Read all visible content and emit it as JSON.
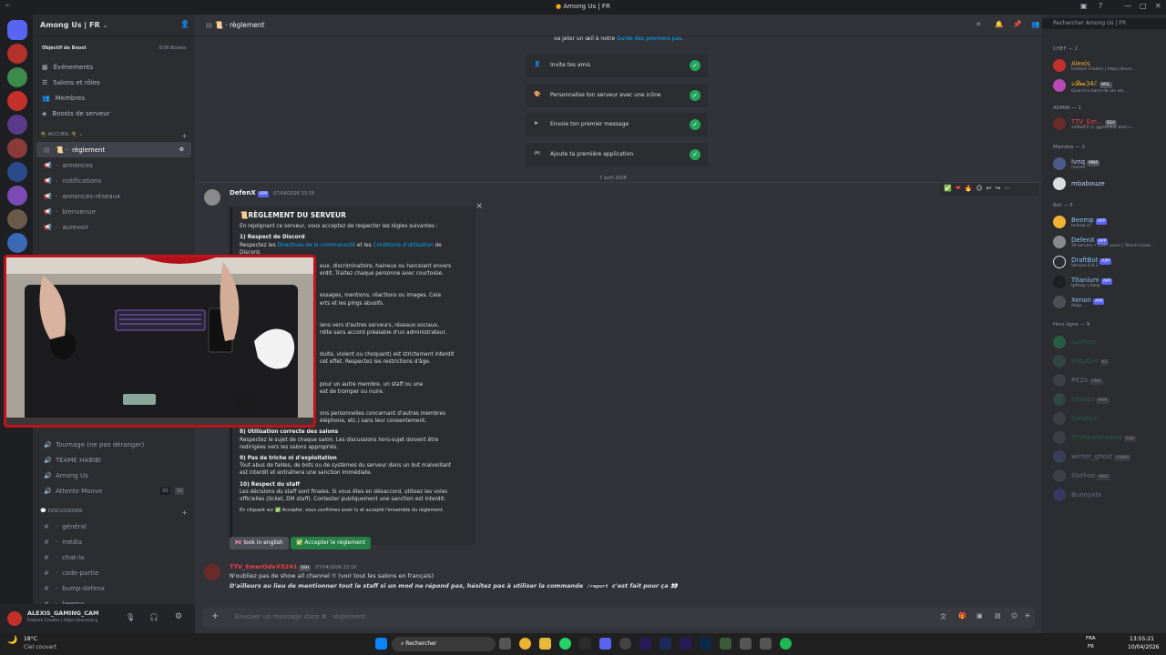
{
  "window": {
    "title": "Among Us | FR"
  },
  "server": {
    "name": "Among Us | FR",
    "boost_label": "Objectif de Boost",
    "boost_count": "0/36 Boosts"
  },
  "menu": [
    "Événements",
    "Salons et rôles",
    "Membres",
    "Boosts de serveur"
  ],
  "categories": {
    "accueil": "ACCUEIL",
    "discussions": "DISCUSSIONS"
  },
  "channels_top": [
    {
      "name": "règlement",
      "selected": true
    },
    {
      "name": "annonces"
    },
    {
      "name": "notifications"
    },
    {
      "name": "annonces-réseaux"
    },
    {
      "name": "bienvenue"
    },
    {
      "name": "aurevoir"
    }
  ],
  "voice_channels": [
    {
      "name": "Tournage (ne pas déranger)"
    },
    {
      "name": "TEAME HABIBI"
    },
    {
      "name": "Among Us"
    },
    {
      "name": "Attente Moove",
      "count_a": "00",
      "count_b": "10"
    }
  ],
  "channels_disc": [
    "général",
    "média",
    "chat-ia",
    "code-partie",
    "bump-defenx",
    "beemo"
  ],
  "user": {
    "name": "ALEXIS_GAMING_CAM",
    "status": "Embark Creator | https://kureect.g"
  },
  "header": {
    "channel": "règlement",
    "search_placeholder": "Rechercher Among Us | FR"
  },
  "welcome": {
    "text_before": "va jeter un œil à notre ",
    "link": "Guide des premiers pas",
    "items": [
      "Invite tes amis",
      "Personnalise ton serveur avec une icône",
      "Envoie ton premier message",
      "Ajoute ta première application"
    ],
    "check": "✓"
  },
  "date_divider": "7 avril 2026",
  "message1": {
    "author": "DefenX",
    "badge": "APP",
    "time": "07/04/2026 23:19",
    "close": "×",
    "embed": {
      "title": "RÈGLEMENT DU SERVEUR",
      "intro": "En rejoignant ce serveur, vous acceptez de respecter les règles suivantes :",
      "r1_title": "1) Respect de Discord",
      "r1_a": "Respectez les ",
      "r1_link1": "Directives de la communauté",
      "r1_b": " et les ",
      "r1_link2": "Conditions d'utilisation",
      "r1_c": " de",
      "r1_d": "Discord.",
      "r2_a": "eux, discriminatoire, haineux ou harcelant envers",
      "r2_b": "erdit. Traitez chaque personne avec courtoisie.",
      "r3_a": "essages, mentions, réactions ou images. Cela",
      "r3_b": "erts et les pings abusifs.",
      "r4_a": "iens vers d'autres serveurs, réseaux sociaux,",
      "r4_b": "rdite sans accord préalable d'un administrateur.",
      "r5_a": "dulte, violent ou choquant) est strictement interdit",
      "r5_b": "cet effet. Respectez les restrictions d'âge.",
      "r6_a": "pour un autre membre, un staff ou une",
      "r6_b": "est de tromper ou nuire.",
      "r7_a": "ons personnelles concernant d'autres membres",
      "r7_b": "éléphone, etc.) sans leur consentement.",
      "r8_title": "8) Utilisation correcte des salons",
      "r8_a": "Respectez le sujet de chaque salon. Les discussions hors-sujet doivent être",
      "r8_b": "redirigées vers les salons appropriés.",
      "r9_title": "9) Pas de triche ni d'exploitation",
      "r9_a": "Tout abus de failles, de bots ou de systèmes du serveur dans un but malveillant",
      "r9_b": "est interdit et entraînera une sanction immédiate.",
      "r10_title": "10) Respect du staff",
      "r10_a": "Les décisions du staff sont finales. Si vous êtes en désaccord, utilisez les voies",
      "r10_b": "officielles (ticket, DM staff). Contester publiquement une sanction est interdit.",
      "footer": "En cliquant sur ✅ Accepter, vous confirmez avoir lu et accepté l'ensemble du règlement."
    },
    "btn_english": "look in english",
    "btn_accept": "Accepter le règlement"
  },
  "message2": {
    "author": "TTV_EmerOde#5241",
    "badge": "SSH",
    "time": "07/04/2026 23:19",
    "line1": "N'oubliez pas de show all channel !! (voir tout les salons en français)",
    "line2_a": "D'ailleurs au lieu de mentionner tout le staff si un mod ne répond pas, hésitez pas à utiliser la commande ",
    "line2_cmd": "/report",
    "line2_b": " c'est fait pour ça 👀"
  },
  "input": {
    "placeholder": "Envoyer un message dans # · règlement"
  },
  "members": {
    "cat_chef": "CHEF — 2",
    "cat_admin": "ADMIN — 1",
    "cat_membre": "Membre — 2",
    "cat_bot": "Bot — 5",
    "cat_offline": "Hors ligne — 9",
    "chef": [
      {
        "name": "Alexis",
        "sub": "Embark Creator | https://kure..."
      },
      {
        "name": "ঌ𝓓𝓮𝓮ℨ4ℰ",
        "tag": "WSL",
        "sub": "Quand la barre de vie est..."
      }
    ],
    "admin": [
      {
        "name": "TTV_Em...",
        "tag": "SSH",
        "sub": "selfbot.fr // .gg/selfbot best s..."
      }
    ],
    "membre": [
      {
        "name": "Ivnq",
        "tag": "MNR",
        "sub": "/nacelr"
      },
      {
        "name": "mbabouze"
      }
    ],
    "bots": [
      {
        "name": "Beemp",
        "badge": "APP",
        "sub": "beemp.cc"
      },
      {
        "name": "DefenX",
        "badge": "APP",
        "sub": "26 servers • 1147 users | Twitch.tv/ser..."
      },
      {
        "name": "DraftBot",
        "badge": "APP",
        "sub": "Version 6.9.2"
      },
      {
        "name": "Titanium",
        "badge": "APP",
        "sub": "tpfhelp | /help"
      },
      {
        "name": "Xenon",
        "badge": "APP",
        "sub": "/help"
      }
    ],
    "offline": [
      {
        "name": "Luishoo"
      },
      {
        "name": "Popy0xe",
        "tag": "Kll"
      },
      {
        "name": "R€Zo",
        "tag": "HNG"
      },
      {
        "name": "Shadyz",
        "tag": "MNR"
      },
      {
        "name": "Svndrys"
      },
      {
        "name": "TheRealShadow",
        "tag": "Sabi"
      },
      {
        "name": "winter_ghost",
        "tag": "HNNM"
      },
      {
        "name": "Slothoo",
        "tag": "MNR"
      },
      {
        "name": "Bunnyxtx"
      }
    ]
  },
  "taskbar": {
    "weather_temp": "18°C",
    "weather_desc": "Ciel couvert",
    "search": "Rechercher",
    "lang1": "FRA",
    "lang2": "FR",
    "time": "13:55:21",
    "date": "10/04/2026"
  },
  "colors": {
    "accent": "#5865f2",
    "green": "#23a55a",
    "link": "#00a8fc",
    "red_frame": "#c3121e"
  }
}
